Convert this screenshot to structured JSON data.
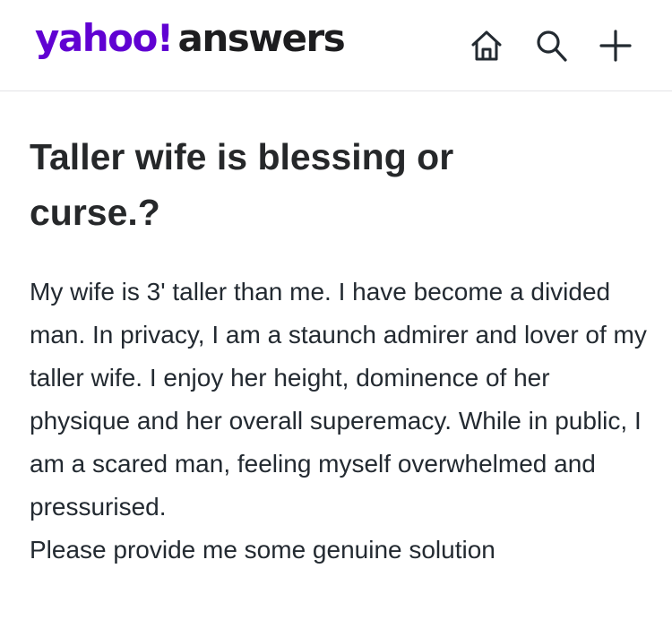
{
  "header": {
    "logo": {
      "yahoo": "yahoo!",
      "answers": "answers"
    },
    "icons": [
      "home-icon",
      "search-icon",
      "plus-icon"
    ]
  },
  "question": {
    "title": "Taller wife is blessing or curse.?",
    "body": "My wife is 3' taller than me. I have become a divided man. In privacy, I am a staunch admirer and lover of my taller wife. I enjoy her height, dominence of her physique and her overall superemacy. While in public, I am a scared man, feeling myself overwhelmed and pressurised.",
    "body_continued": "Please provide me some genuine solution"
  },
  "colors": {
    "brand": "#6001d2",
    "text": "#26282a",
    "divider": "#e3e3e6"
  }
}
